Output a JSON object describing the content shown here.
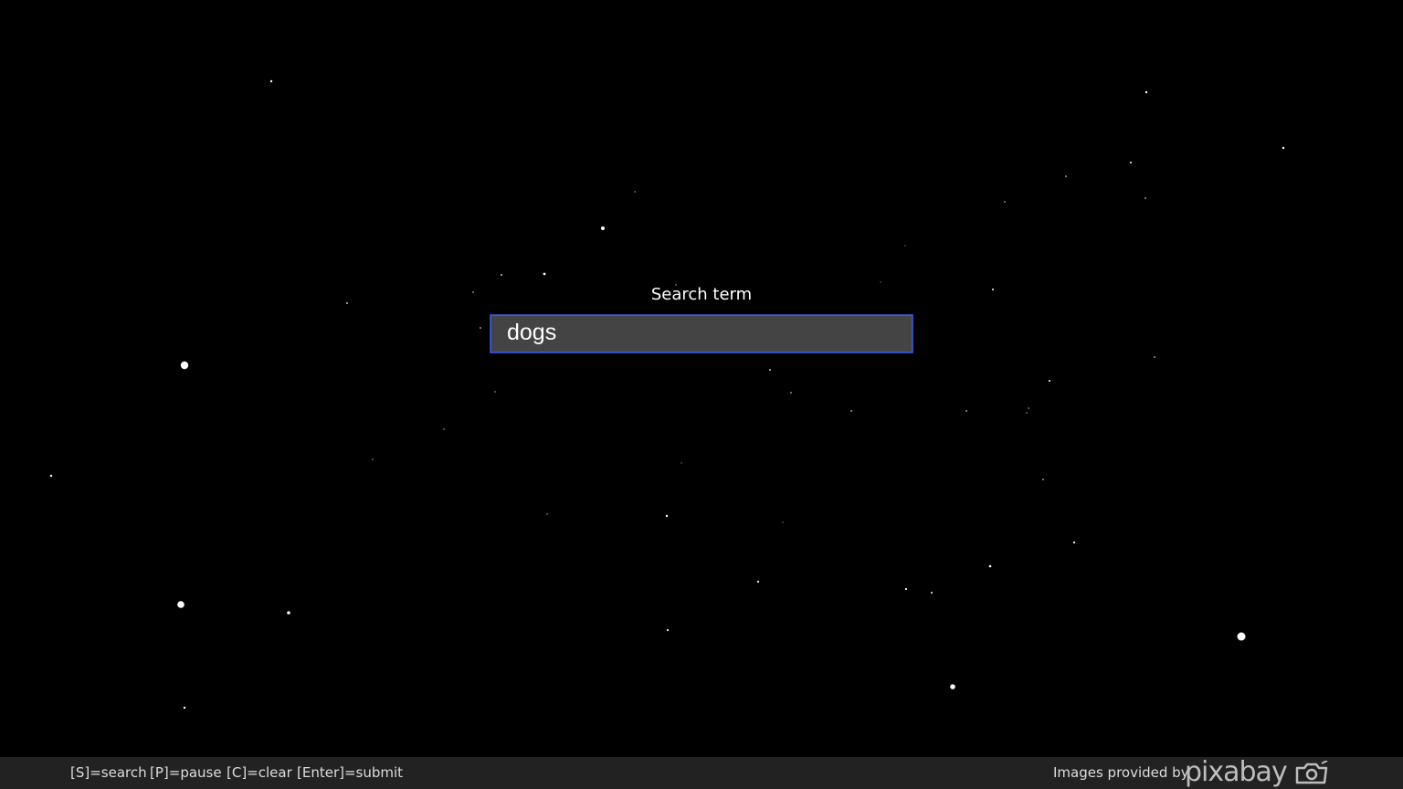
{
  "search": {
    "label": "Search term",
    "value": "dogs"
  },
  "bottom_bar": {
    "hints": [
      "[S]=search",
      "[P]=pause",
      "[C]=clear",
      "[Enter]=submit"
    ],
    "credit": "Images provided by",
    "brand": "pixabay",
    "brand_icon": "camera-icon"
  },
  "colors": {
    "background": "#000000",
    "star": "#ffffff",
    "input_background": "#444444",
    "input_border": "#3b5bdb",
    "bar_background": "#222222",
    "bar_text": "#dddddd",
    "brand_gray": "#bdbdbd"
  }
}
